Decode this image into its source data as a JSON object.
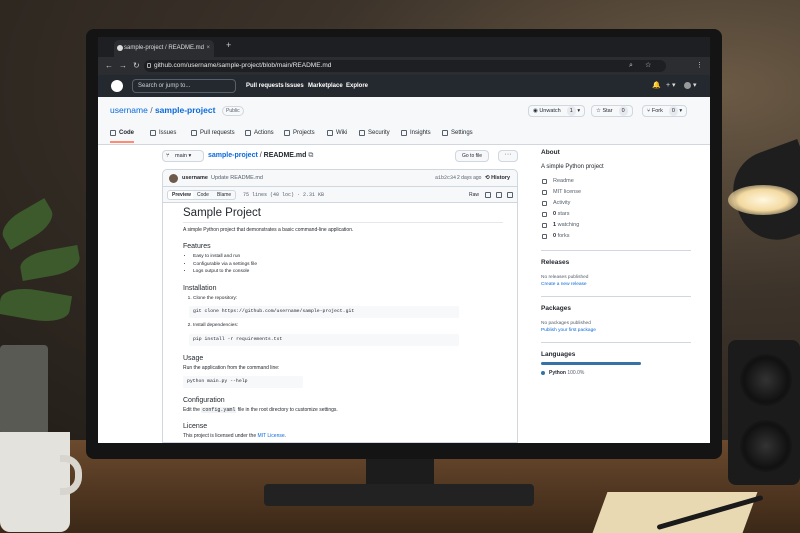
{
  "browser": {
    "tab_title": "sample-project / README.md",
    "tab_close": "×",
    "new_tab": "+",
    "url": "github.com/username/sample-project/blob/main/README.md",
    "back": "←",
    "forward": "→",
    "reload": "↻",
    "zoom": "⌕",
    "star": "☆",
    "menu": "⋮"
  },
  "github": {
    "search_placeholder": "Search or jump to...",
    "nav": [
      "Pull requests",
      "Issues",
      "Marketplace",
      "Explore"
    ],
    "bell": "🔔",
    "plus": "+ ▾",
    "avatar_menu": "▾"
  },
  "repo": {
    "owner": "username",
    "separator": "/",
    "name": "sample-project",
    "visibility": "Public",
    "unwatch_label": "Unwatch",
    "unwatch_count": "1",
    "star_label": "Star",
    "star_count": "0",
    "fork_label": "Fork",
    "fork_count": "0",
    "tabs": [
      "Code",
      "Issues",
      "Pull requests",
      "Actions",
      "Projects",
      "Wiki",
      "Security",
      "Insights",
      "Settings"
    ]
  },
  "file": {
    "branch": "main ▾",
    "repo_link": "sample-project",
    "crumb_sep": " / ",
    "filename": "README.md",
    "copy_icon": "⧉",
    "go_to_file": "Go to file",
    "more": "···",
    "commit_user": "username",
    "commit_msg": "Update README.md",
    "commit_sha": "a1b2c34",
    "commit_time": "2 days ago",
    "history": "History",
    "view_preview": "Preview",
    "view_code": "Code",
    "view_blame": "Blame",
    "meta": "75 lines (40 loc) · 2.31 KB",
    "raw": "Raw"
  },
  "readme": {
    "title": "Sample Project",
    "intro": "A simple Python project that demonstrates a basic command-line application.",
    "features_h": "Features",
    "features": [
      "Easy to install and run",
      "Configurable via a settings file",
      "Logs output to the console"
    ],
    "install_h": "Installation",
    "step1": "Clone the repository:",
    "clone_cmd": "git clone https://github.com/username/sample-project.git",
    "step2": "Install dependencies:",
    "pip_cmd": "pip install -r requirements.txt",
    "usage_h": "Usage",
    "usage_text": "Run the application from the command line:",
    "run_cmd": "python main.py --help",
    "config_h": "Configuration",
    "config_pre": "Edit the ",
    "config_file": "config.yaml",
    "config_post": " file in the root directory to customize settings.",
    "license_h": "License",
    "license_pre": "This project is licensed under the ",
    "license_link": "MIT License",
    "license_post": "."
  },
  "sidebar": {
    "about_h": "About",
    "description": "A simple Python project",
    "readme": "Readme",
    "license": "MIT license",
    "activity": "Activity",
    "stars_n": "0",
    "stars_label": "stars",
    "watching_n": "1",
    "watching_label": "watching",
    "forks_n": "0",
    "forks_label": "forks",
    "releases_h": "Releases",
    "no_releases": "No releases published",
    "create_release": "Create a new release",
    "packages_h": "Packages",
    "no_packages": "No packages published",
    "publish_package": "Publish your first package",
    "languages_h": "Languages",
    "lang_name": "Python",
    "lang_pct": "100.0%",
    "lang_color": "#3572A5",
    "lang_fraction": 1.0
  }
}
